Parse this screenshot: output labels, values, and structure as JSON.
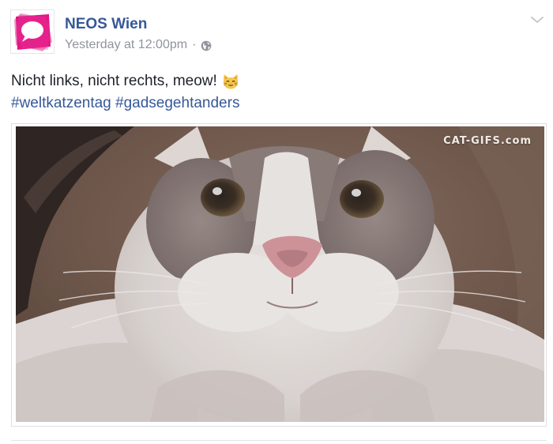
{
  "post": {
    "author": "NEOS Wien",
    "timestamp": "Yesterday at 12:00pm",
    "separator": "·",
    "privacy_icon": "globe-icon",
    "menu_icon": "chevron-down-icon",
    "message": "Nicht links, nicht rechts, meow!",
    "emoji": "cat-face-emoji",
    "hashtags": [
      "#weltkatzentag",
      "#gadsegehtanders"
    ],
    "media": {
      "type": "animated-gif",
      "subject": "cat",
      "watermark": "CAT-GIFS.com"
    }
  },
  "colors": {
    "link": "#365899",
    "meta": "#90949c",
    "text": "#1d2129",
    "brand_pink": "#e4007e"
  }
}
